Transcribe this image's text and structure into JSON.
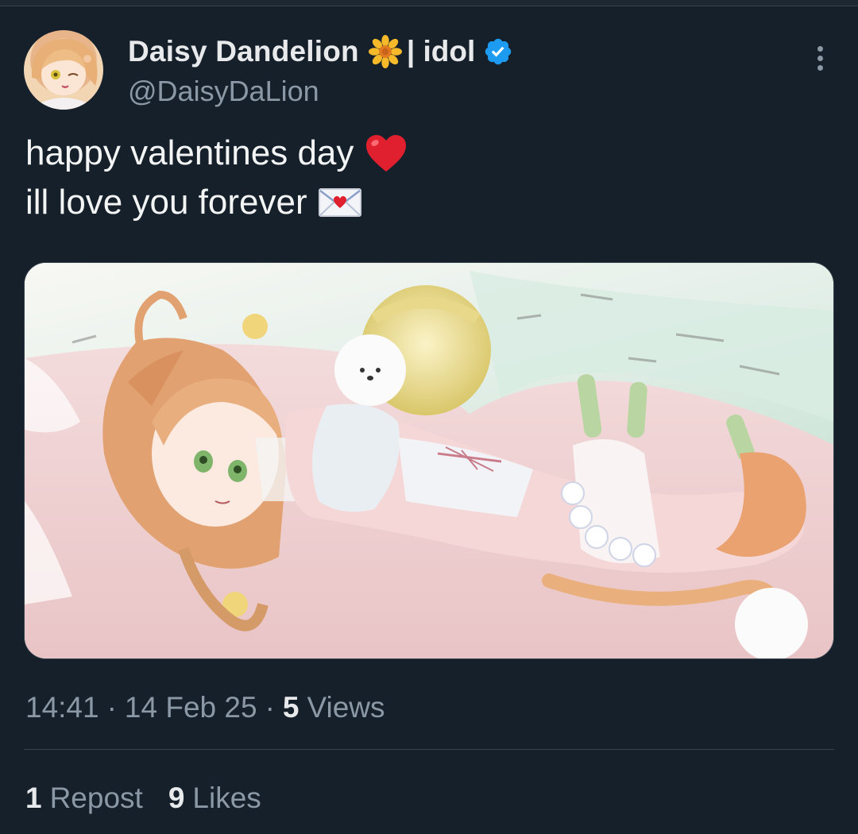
{
  "author": {
    "display_name": "Daisy Dandelion",
    "name_suffix": "| idol",
    "handle": "@DaisyDaLion",
    "verified_color": "#1d9bf0"
  },
  "tweet": {
    "lines": [
      "happy valentines day",
      "ill love you forever"
    ],
    "line_emojis": [
      "heart-icon",
      "love-letter-icon"
    ]
  },
  "meta": {
    "time": "14:41",
    "separator": "·",
    "date": "14 Feb 25",
    "views_count": "5",
    "views_label": "Views"
  },
  "stats": {
    "reposts_count": "1",
    "reposts_label": "Repost",
    "likes_count": "9",
    "likes_label": "Likes"
  },
  "colors": {
    "background": "#15202b",
    "text": "#e7e9ea",
    "secondary": "#8b98a5",
    "border": "#38444d"
  }
}
